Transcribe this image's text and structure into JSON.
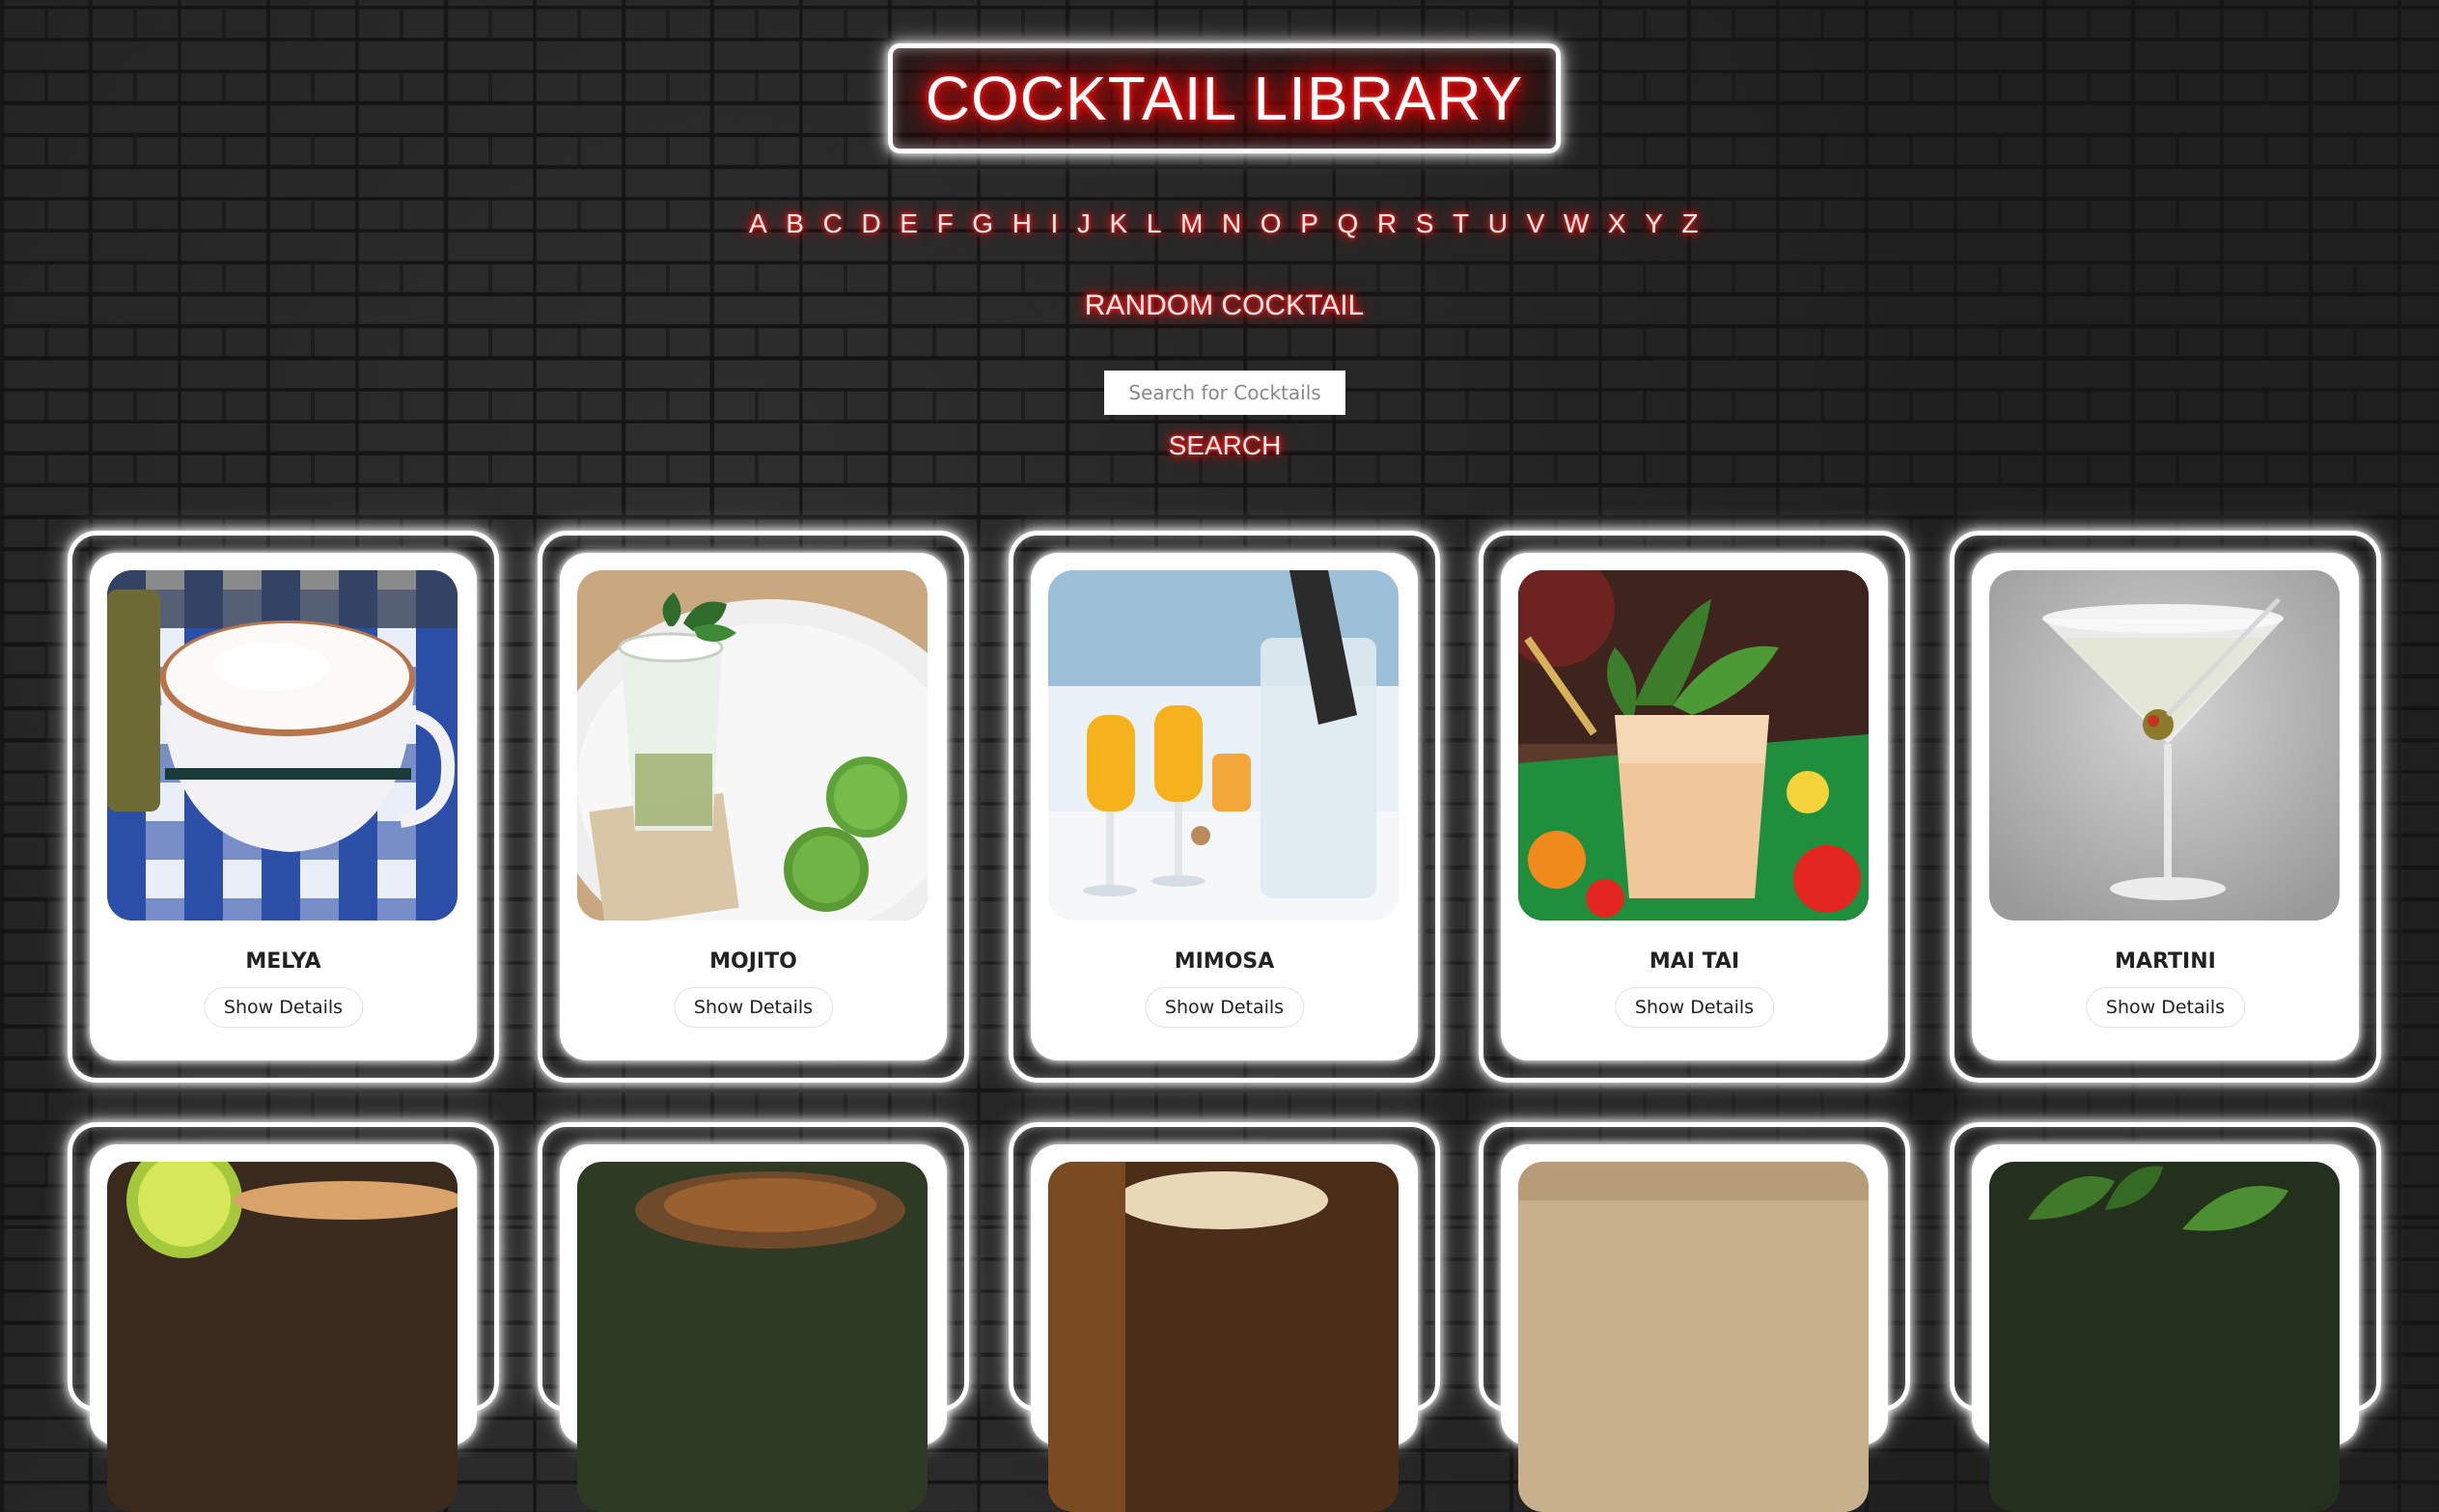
{
  "header": {
    "title": "COCKTAIL LIBRARY"
  },
  "alphabet": [
    "A",
    "B",
    "C",
    "D",
    "E",
    "F",
    "G",
    "H",
    "I",
    "J",
    "K",
    "L",
    "M",
    "N",
    "O",
    "P",
    "Q",
    "R",
    "S",
    "T",
    "U",
    "V",
    "W",
    "X",
    "Y",
    "Z"
  ],
  "random_label": "RANDOM COCKTAIL",
  "search": {
    "placeholder": "Search for Cocktails",
    "button_label": "SEARCH"
  },
  "cards": [
    {
      "name": "MELYA",
      "button": "Show Details"
    },
    {
      "name": "MOJITO",
      "button": "Show Details"
    },
    {
      "name": "MIMOSA",
      "button": "Show Details"
    },
    {
      "name": "MAI TAI",
      "button": "Show Details"
    },
    {
      "name": "MARTINI",
      "button": "Show Details"
    }
  ],
  "colors": {
    "neon_red": "#ff0000",
    "neon_white": "#ffffff",
    "wall": "#252525"
  }
}
